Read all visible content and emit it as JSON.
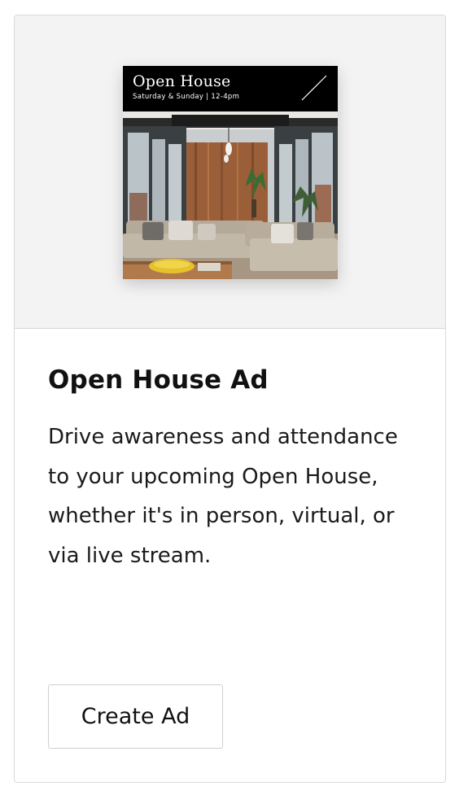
{
  "ad_preview": {
    "title": "Open House",
    "subtitle": "Saturday & Sunday | 12-4pm"
  },
  "card": {
    "title": "Open House Ad",
    "description": "Drive awareness and attendance to your upcoming Open House, whether it's in person, virtual, or via live stream.",
    "button_label": "Create Ad"
  }
}
